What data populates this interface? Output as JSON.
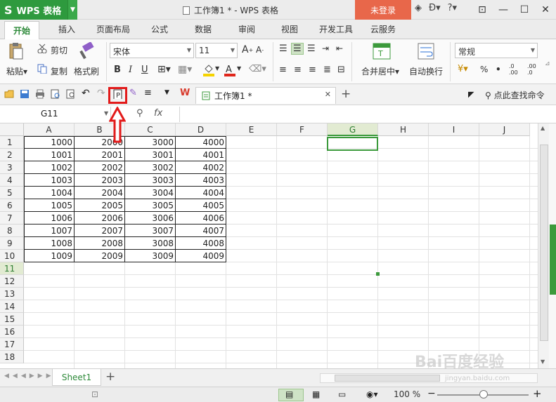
{
  "titlebar": {
    "app_name": "WPS 表格",
    "doc_title": "工作簿1 * - WPS 表格",
    "login": "未登录"
  },
  "tabs": [
    "开始",
    "插入",
    "页面布局",
    "公式",
    "数据",
    "审阅",
    "视图",
    "开发工具",
    "云服务"
  ],
  "ribbon": {
    "paste": "粘贴",
    "cut": "剪切",
    "copy": "复制",
    "format_painter": "格式刷",
    "font_name": "宋体",
    "font_size": "11",
    "merge_center": "合并居中",
    "wrap_text": "自动换行",
    "number_format": "常规",
    "percent": "%",
    "comma": "•",
    "inc_dec": ".0 .00",
    "dec_dec": ".00 .0"
  },
  "qat": {
    "doc_tab": "工作簿1 *",
    "find_command": "点此查找命令"
  },
  "formula_bar": {
    "name_box": "G11",
    "fx": "fx"
  },
  "columns": [
    "A",
    "B",
    "C",
    "D",
    "E",
    "F",
    "G",
    "H",
    "I",
    "J"
  ],
  "rows": [
    "1",
    "2",
    "3",
    "4",
    "5",
    "6",
    "7",
    "8",
    "9",
    "10",
    "11",
    "12",
    "13",
    "14",
    "15",
    "16",
    "17",
    "18"
  ],
  "data": [
    [
      "1000",
      "2000",
      "3000",
      "4000"
    ],
    [
      "1001",
      "2001",
      "3001",
      "4001"
    ],
    [
      "1002",
      "2002",
      "3002",
      "4002"
    ],
    [
      "1003",
      "2003",
      "3003",
      "4003"
    ],
    [
      "1004",
      "2004",
      "3004",
      "4004"
    ],
    [
      "1005",
      "2005",
      "3005",
      "4005"
    ],
    [
      "1006",
      "2006",
      "3006",
      "4006"
    ],
    [
      "1007",
      "2007",
      "3007",
      "4007"
    ],
    [
      "1008",
      "2008",
      "3008",
      "4008"
    ],
    [
      "1009",
      "2009",
      "3009",
      "4009"
    ]
  ],
  "selected_cell": "G11",
  "sheet_tab": "Sheet1",
  "status": {
    "zoom": "100 %"
  },
  "watermark": {
    "brand": "Bai百度经验",
    "url": "jingyan.baidu.com"
  },
  "colors": {
    "accent_green": "#2e9a3e",
    "login_orange": "#e8674a",
    "highlight_red": "#e21a1a"
  }
}
